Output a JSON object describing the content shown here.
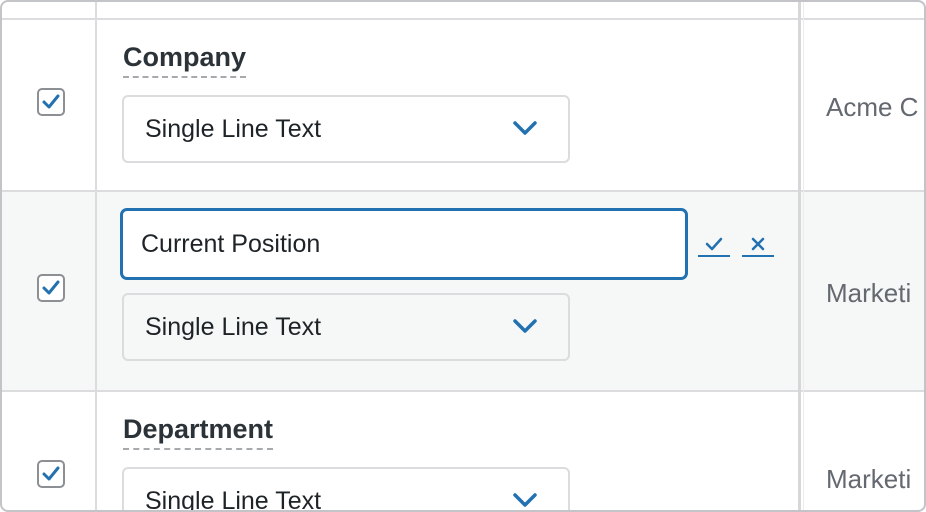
{
  "rows": [
    {
      "field_label": "Company",
      "type_select": "Single Line Text",
      "value": "Acme C",
      "enabled": true
    },
    {
      "field_label_input": "Current Position",
      "type_select": "Single Line Text",
      "value": "Marketi",
      "enabled": true,
      "confirm_icon": "check-icon",
      "cancel_icon": "close-icon"
    },
    {
      "field_label": "Department",
      "type_select": "Single Line Text",
      "value": "Marketi",
      "enabled": true
    }
  ],
  "colors": {
    "accent": "#2271b1",
    "border": "#dcdcde",
    "editing_row_bg": "#f6f7f7",
    "muted_text": "#646970"
  }
}
